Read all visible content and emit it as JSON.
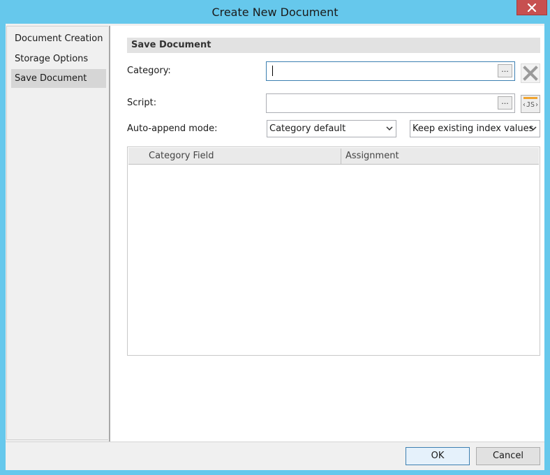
{
  "window": {
    "title": "Create New Document",
    "close_glyph": "X"
  },
  "nav": {
    "items": [
      {
        "label": "Document Creation",
        "selected": false
      },
      {
        "label": "Storage Options",
        "selected": false
      },
      {
        "label": "Save Document",
        "selected": true
      }
    ]
  },
  "section": {
    "title": "Save Document"
  },
  "form": {
    "category_label": "Category:",
    "category_value": "",
    "category_browse": "...",
    "script_label": "Script:",
    "script_value": "",
    "script_browse": "...",
    "js_icon_text": "‹JS›",
    "auto_append_label": "Auto-append mode:",
    "auto_append_mode_value": "Category default",
    "index_values_mode_value": "Keep existing index values"
  },
  "grid": {
    "columns": [
      "Category Field",
      "Assignment"
    ],
    "rows": []
  },
  "buttons": {
    "ok": "OK",
    "cancel": "Cancel"
  },
  "colors": {
    "window_frame": "#66c8ec",
    "close_button": "#c75050",
    "section_header": "#e2e2e2",
    "selected_nav": "#d6d6d6",
    "js_icon_accent": "#f0a430"
  },
  "icons": {
    "close": "close-icon",
    "clear": "clear-x-icon",
    "javascript": "js-script-icon",
    "dropdown": "chevron-down-icon"
  }
}
